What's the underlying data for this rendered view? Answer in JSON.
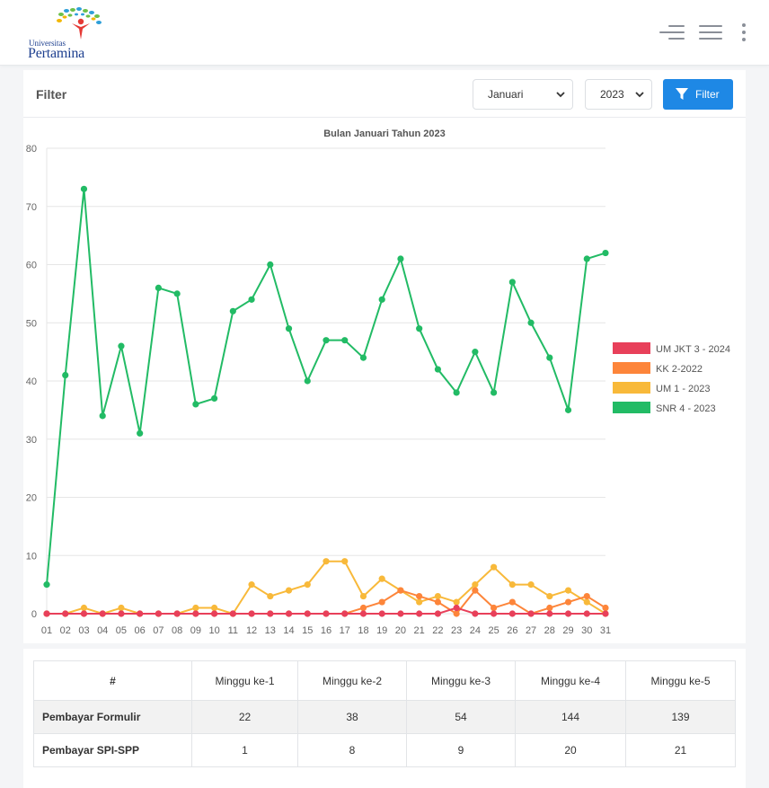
{
  "header": {
    "logo": {
      "line1": "Universitas",
      "line2": "Pertamina"
    },
    "menu_icon": "hamburger-icon",
    "nav_icon": "menu-icon",
    "more_icon": "vertical-dots-icon"
  },
  "filter": {
    "title": "Filter",
    "month_selected": "Januari",
    "year_selected": "2023",
    "button_label": "Filter",
    "button_icon": "funnel-icon",
    "button_color": "#1e88e5"
  },
  "chart_data": {
    "type": "line",
    "title": "Bulan Januari Tahun 2023",
    "categories": [
      "01",
      "02",
      "03",
      "04",
      "05",
      "06",
      "07",
      "08",
      "09",
      "10",
      "11",
      "12",
      "13",
      "14",
      "15",
      "16",
      "17",
      "18",
      "19",
      "20",
      "21",
      "22",
      "23",
      "24",
      "25",
      "26",
      "27",
      "28",
      "29",
      "30",
      "31"
    ],
    "ylim": [
      0,
      80
    ],
    "yticks": [
      0,
      10,
      20,
      30,
      40,
      50,
      60,
      70,
      80
    ],
    "grid": true,
    "legend_position": "right",
    "series": [
      {
        "name": "UM JKT 3 - 2024",
        "color": "#e8405a",
        "values": [
          0,
          0,
          0,
          0,
          0,
          0,
          0,
          0,
          0,
          0,
          0,
          0,
          0,
          0,
          0,
          0,
          0,
          0,
          0,
          0,
          0,
          0,
          1,
          0,
          0,
          0,
          0,
          0,
          0,
          0,
          0
        ]
      },
      {
        "name": "KK 2-2022",
        "color": "#fd853a",
        "values": [
          0,
          0,
          0,
          0,
          0,
          0,
          0,
          0,
          0,
          0,
          0,
          0,
          0,
          0,
          0,
          0,
          0,
          1,
          2,
          4,
          3,
          2,
          0,
          4,
          1,
          2,
          0,
          1,
          2,
          3,
          1
        ]
      },
      {
        "name": "UM 1 - 2023",
        "color": "#f8b93a",
        "values": [
          0,
          0,
          1,
          0,
          1,
          0,
          0,
          0,
          1,
          1,
          0,
          5,
          3,
          4,
          5,
          9,
          9,
          3,
          6,
          4,
          2,
          3,
          2,
          5,
          8,
          5,
          5,
          3,
          4,
          2,
          0
        ]
      },
      {
        "name": "SNR 4 - 2023",
        "color": "#22bb65",
        "values": [
          5,
          41,
          73,
          34,
          46,
          31,
          56,
          55,
          36,
          37,
          52,
          54,
          60,
          49,
          40,
          47,
          47,
          44,
          54,
          61,
          49,
          42,
          38,
          45,
          38,
          57,
          50,
          44,
          35,
          61,
          62
        ]
      }
    ]
  },
  "table": {
    "headers": [
      "#",
      "Minggu ke-1",
      "Minggu ke-2",
      "Minggu ke-3",
      "Minggu ke-4",
      "Minggu ke-5"
    ],
    "rows": [
      {
        "label": "Pembayar Formulir",
        "values": [
          "22",
          "38",
          "54",
          "144",
          "139"
        ]
      },
      {
        "label": "Pembayar SPI-SPP",
        "values": [
          "1",
          "8",
          "9",
          "20",
          "21"
        ]
      }
    ]
  }
}
